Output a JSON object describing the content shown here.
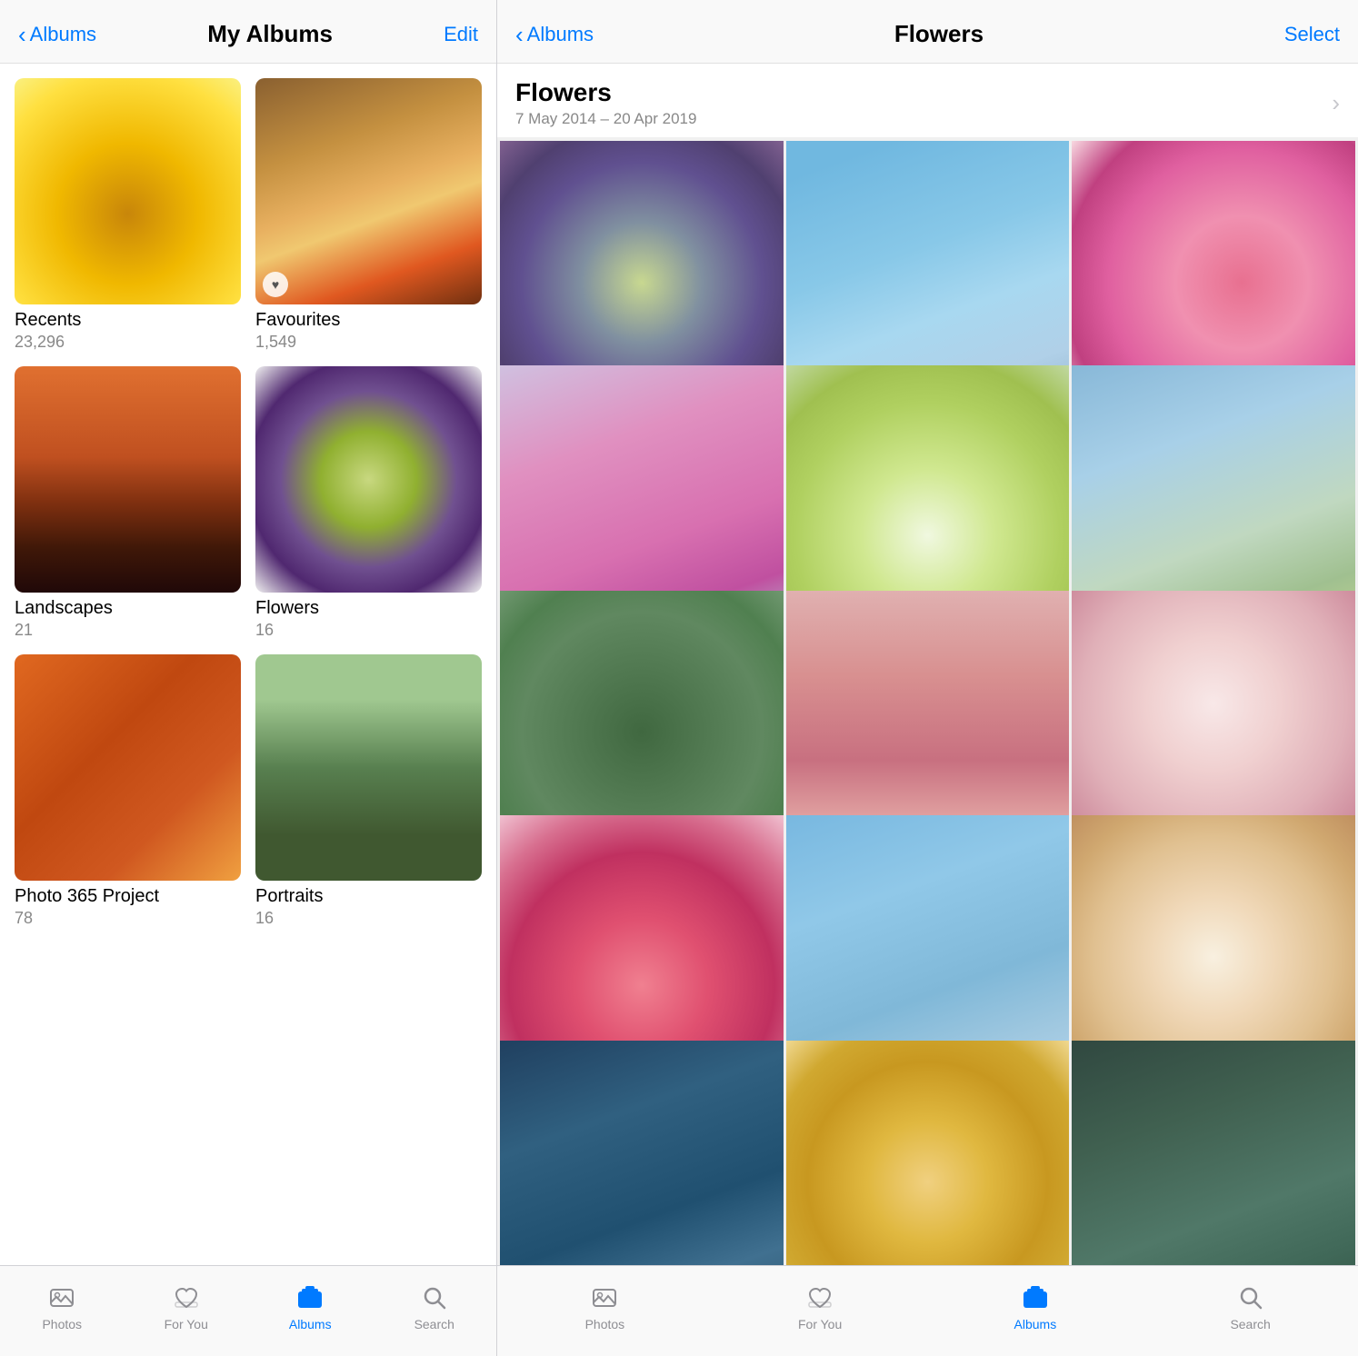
{
  "left": {
    "nav": {
      "back_label": "Albums",
      "title": "My Albums",
      "action_label": "Edit"
    },
    "albums": [
      {
        "id": "recents",
        "name": "Recents",
        "count": "23,296",
        "has_heart": false,
        "thumb_class": "thumb-recents-detail"
      },
      {
        "id": "favourites",
        "name": "Favourites",
        "count": "1,549",
        "has_heart": true,
        "thumb_class": "thumb-favourites"
      },
      {
        "id": "landscapes",
        "name": "Landscapes",
        "count": "21",
        "has_heart": false,
        "thumb_class": "thumb-landscapes"
      },
      {
        "id": "flowers",
        "name": "Flowers",
        "count": "16",
        "has_heart": false,
        "thumb_class": "thumb-flowers"
      },
      {
        "id": "photo365",
        "name": "Photo 365 Project",
        "count": "78",
        "has_heart": false,
        "thumb_class": "thumb-photo365"
      },
      {
        "id": "portraits",
        "name": "Portraits",
        "count": "16",
        "has_heart": false,
        "thumb_class": "thumb-portraits"
      }
    ],
    "tabs": [
      {
        "id": "photos",
        "label": "Photos",
        "active": false
      },
      {
        "id": "foryou",
        "label": "For You",
        "active": false
      },
      {
        "id": "albums",
        "label": "Albums",
        "active": true
      },
      {
        "id": "search",
        "label": "Search",
        "active": false
      }
    ]
  },
  "right": {
    "nav": {
      "back_label": "Albums",
      "title": "Flowers",
      "action_label": "Select"
    },
    "album_title": "Flowers",
    "album_dates": "7 May 2014 – 20 Apr 2019",
    "photos": [
      {
        "id": 1,
        "has_heart": true,
        "color_class": "f1"
      },
      {
        "id": 2,
        "has_heart": true,
        "color_class": "f2"
      },
      {
        "id": 3,
        "has_heart": false,
        "color_class": "f3"
      },
      {
        "id": 4,
        "has_heart": true,
        "color_class": "f4"
      },
      {
        "id": 5,
        "has_heart": true,
        "color_class": "f5"
      },
      {
        "id": 6,
        "has_heart": true,
        "color_class": "f6"
      },
      {
        "id": 7,
        "has_heart": false,
        "color_class": "f7"
      },
      {
        "id": 8,
        "has_heart": false,
        "color_class": "f8"
      },
      {
        "id": 9,
        "has_heart": false,
        "color_class": "f9"
      },
      {
        "id": 10,
        "has_heart": false,
        "color_class": "f10"
      },
      {
        "id": 11,
        "has_heart": true,
        "color_class": "f11"
      },
      {
        "id": 12,
        "has_heart": true,
        "color_class": "f12"
      },
      {
        "id": 13,
        "has_heart": false,
        "color_class": "f13"
      },
      {
        "id": 14,
        "has_heart": false,
        "color_class": "f14"
      },
      {
        "id": 15,
        "has_heart": false,
        "color_class": "f15"
      }
    ],
    "tabs": [
      {
        "id": "photos",
        "label": "Photos",
        "active": false
      },
      {
        "id": "foryou",
        "label": "For You",
        "active": false
      },
      {
        "id": "albums",
        "label": "Albums",
        "active": true
      },
      {
        "id": "search",
        "label": "Search",
        "active": false
      }
    ]
  }
}
